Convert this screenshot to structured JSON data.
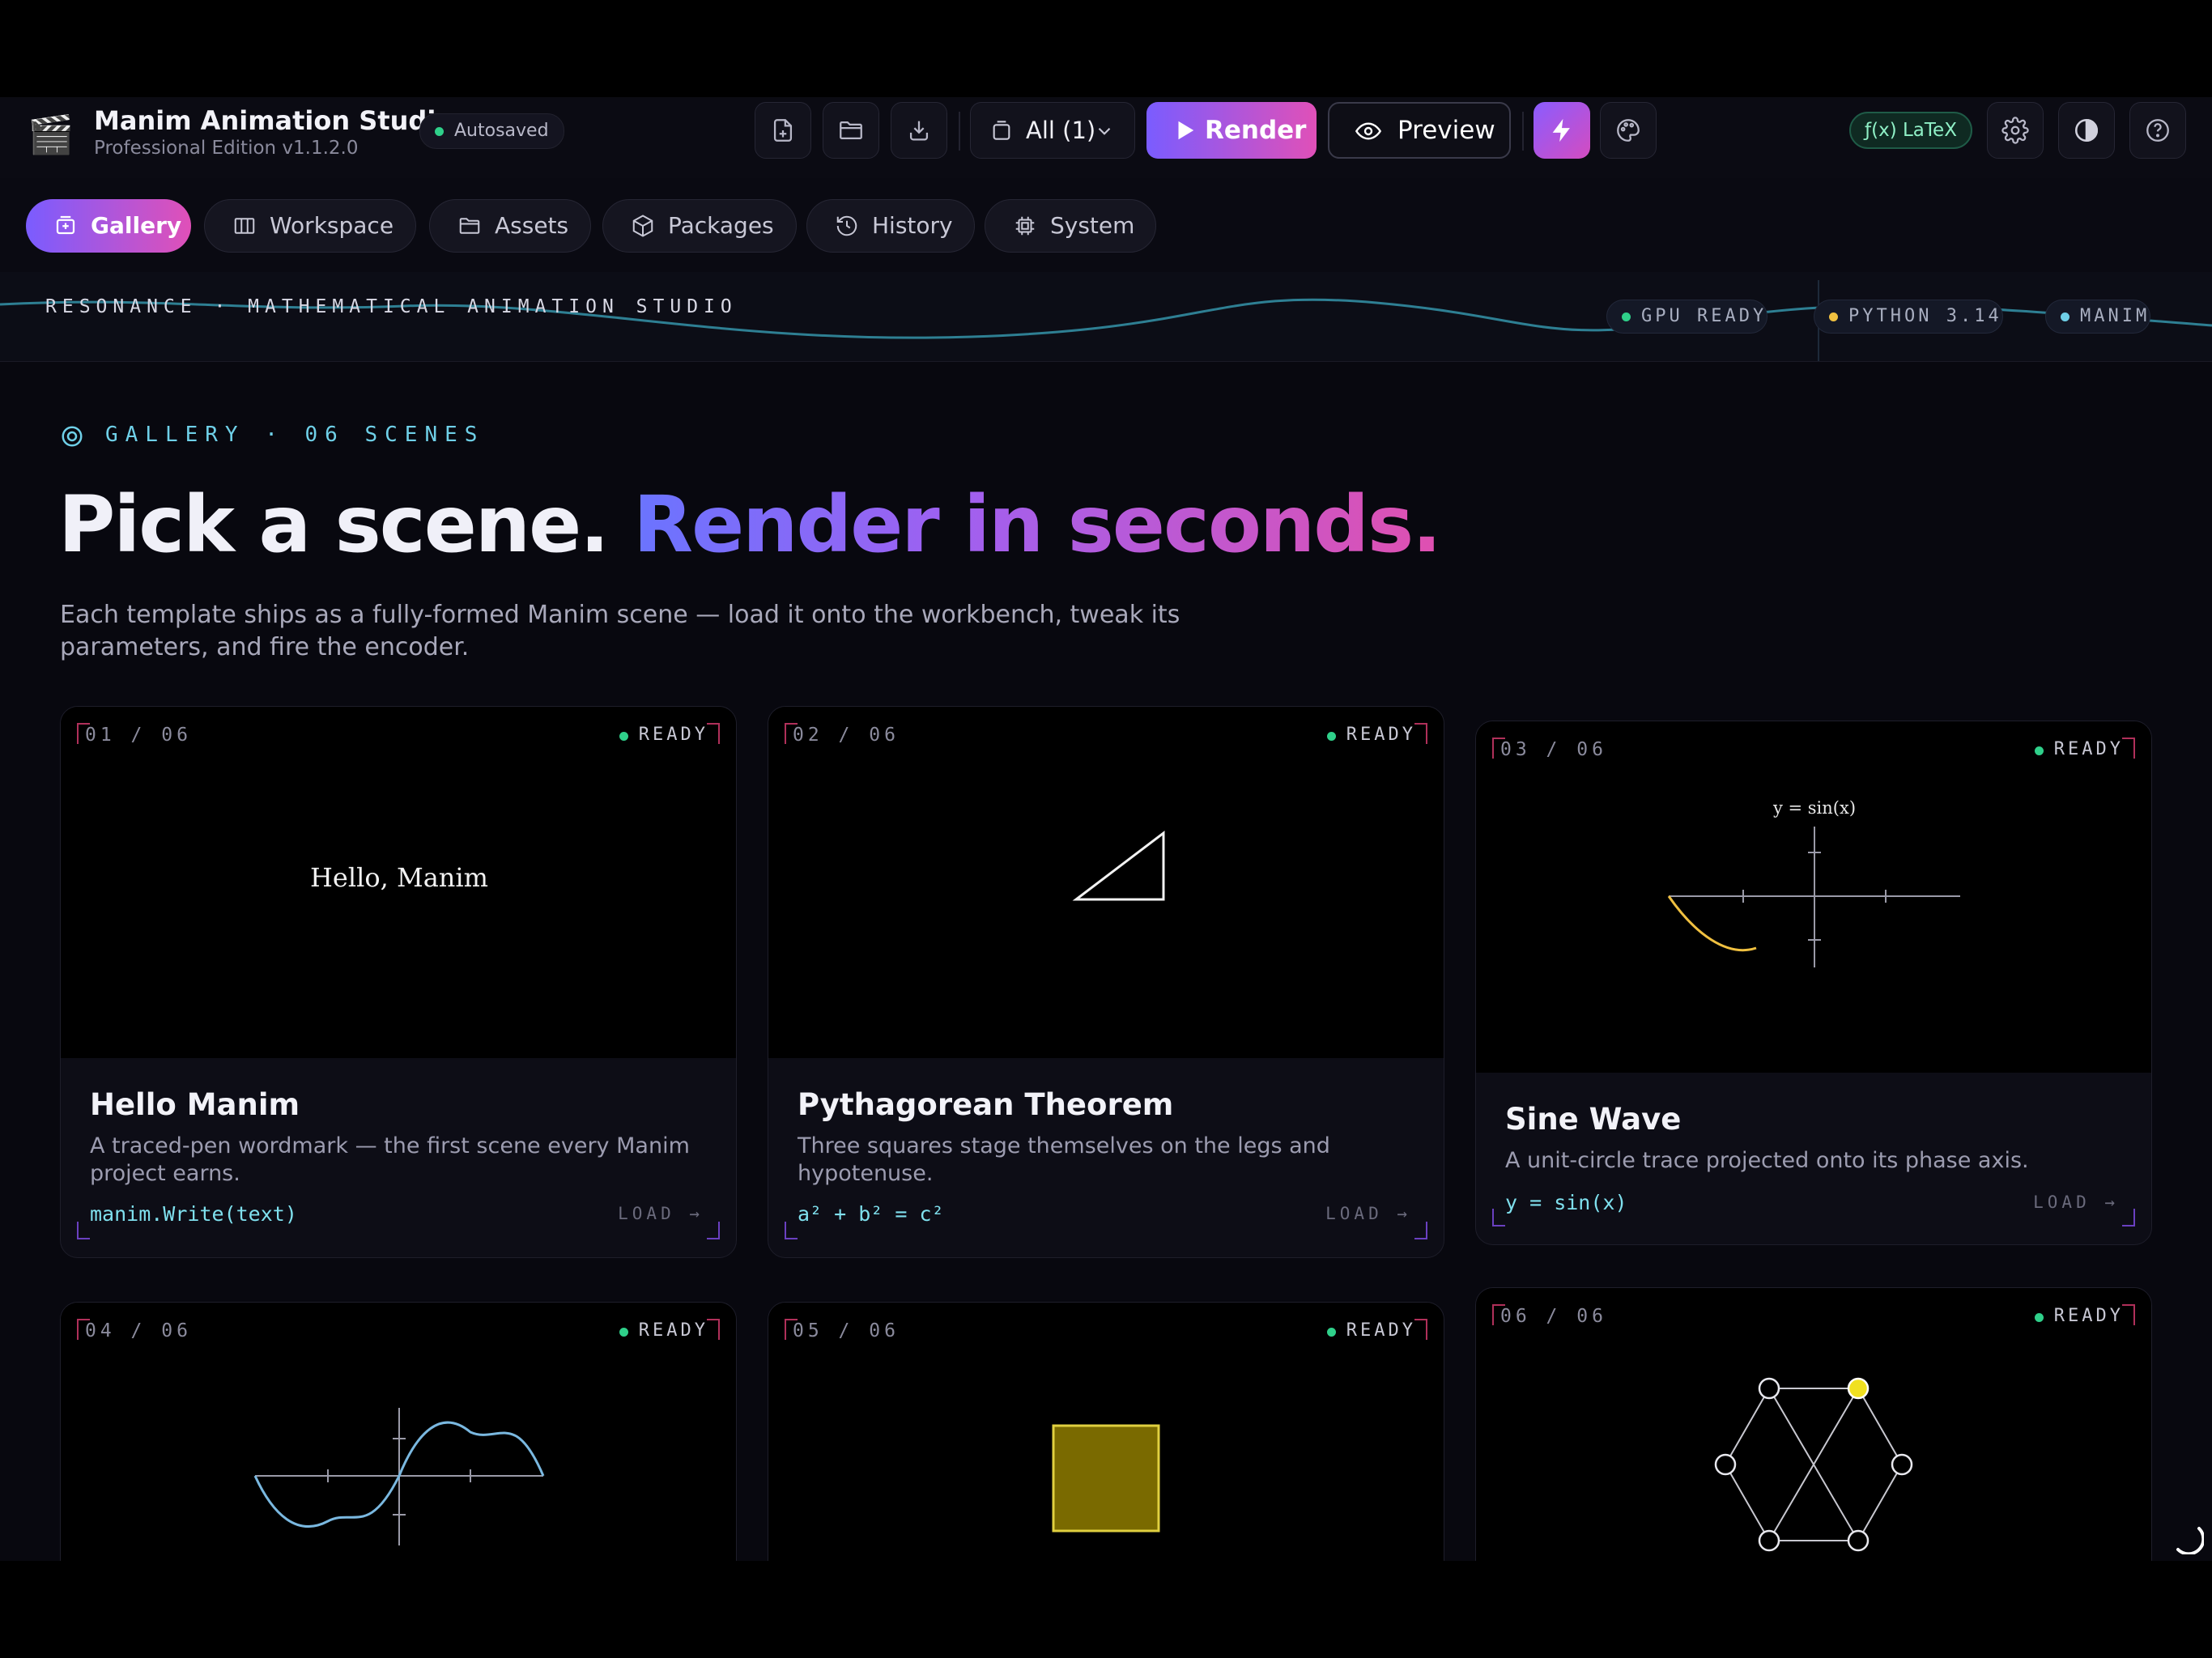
{
  "header": {
    "app_icon": "clapperboard-icon",
    "title": "Manim Animation Studio",
    "subtitle": "Professional Edition v1.1.2.0",
    "autosave_label": "Autosaved",
    "scene_filter_label": "All (1)",
    "render_label": "Render",
    "preview_label": "Preview",
    "latex_label": "ƒ(x)  LaTeX"
  },
  "tabs": [
    {
      "label": "Gallery",
      "icon": "gallery-icon",
      "active": true
    },
    {
      "label": "Workspace",
      "icon": "columns-icon",
      "active": false
    },
    {
      "label": "Assets",
      "icon": "folder-icon",
      "active": false
    },
    {
      "label": "Packages",
      "icon": "package-icon",
      "active": false
    },
    {
      "label": "History",
      "icon": "history-icon",
      "active": false
    },
    {
      "label": "System",
      "icon": "chip-icon",
      "active": false
    }
  ],
  "banner": {
    "text": "RESONANCE · MATHEMATICAL ANIMATION STUDIO",
    "status": [
      "GPU READY",
      "PYTHON 3.14",
      "MANIM"
    ]
  },
  "gallery": {
    "label": "GALLERY · 06 SCENES",
    "title_plain": "Pick a scene.",
    "title_accent": "Render in seconds.",
    "description": "Each template ships as a fully-formed Manim scene — load it onto the workbench, tweak its parameters, and fire the encoder."
  },
  "cards": [
    {
      "index": "01 / 06",
      "status": "READY",
      "preview_text": "Hello, Manim",
      "title": "Hello Manim",
      "description": "A traced-pen wordmark — the first scene every Manim project earns.",
      "code": "manim.Write(text)",
      "action": "LOAD →"
    },
    {
      "index": "02 / 06",
      "status": "READY",
      "title": "Pythagorean Theorem",
      "description": "Three squares stage themselves on the legs and hypotenuse.",
      "code": "a² + b² = c²",
      "action": "LOAD →"
    },
    {
      "index": "03 / 06",
      "status": "READY",
      "preview_text": "y = sin(x)",
      "title": "Sine Wave",
      "description": "A unit-circle trace projected onto its phase axis.",
      "code": "y = sin(x)",
      "action": "LOAD →"
    },
    {
      "index": "04 / 06",
      "status": "READY"
    },
    {
      "index": "05 / 06",
      "status": "READY"
    },
    {
      "index": "06 / 06",
      "status": "READY"
    }
  ],
  "colors": {
    "accent_start": "#7a5cff",
    "accent_end": "#e050b8",
    "ready": "#2fd08a",
    "code": "#7fe0ee",
    "sine": "#f0c040"
  }
}
